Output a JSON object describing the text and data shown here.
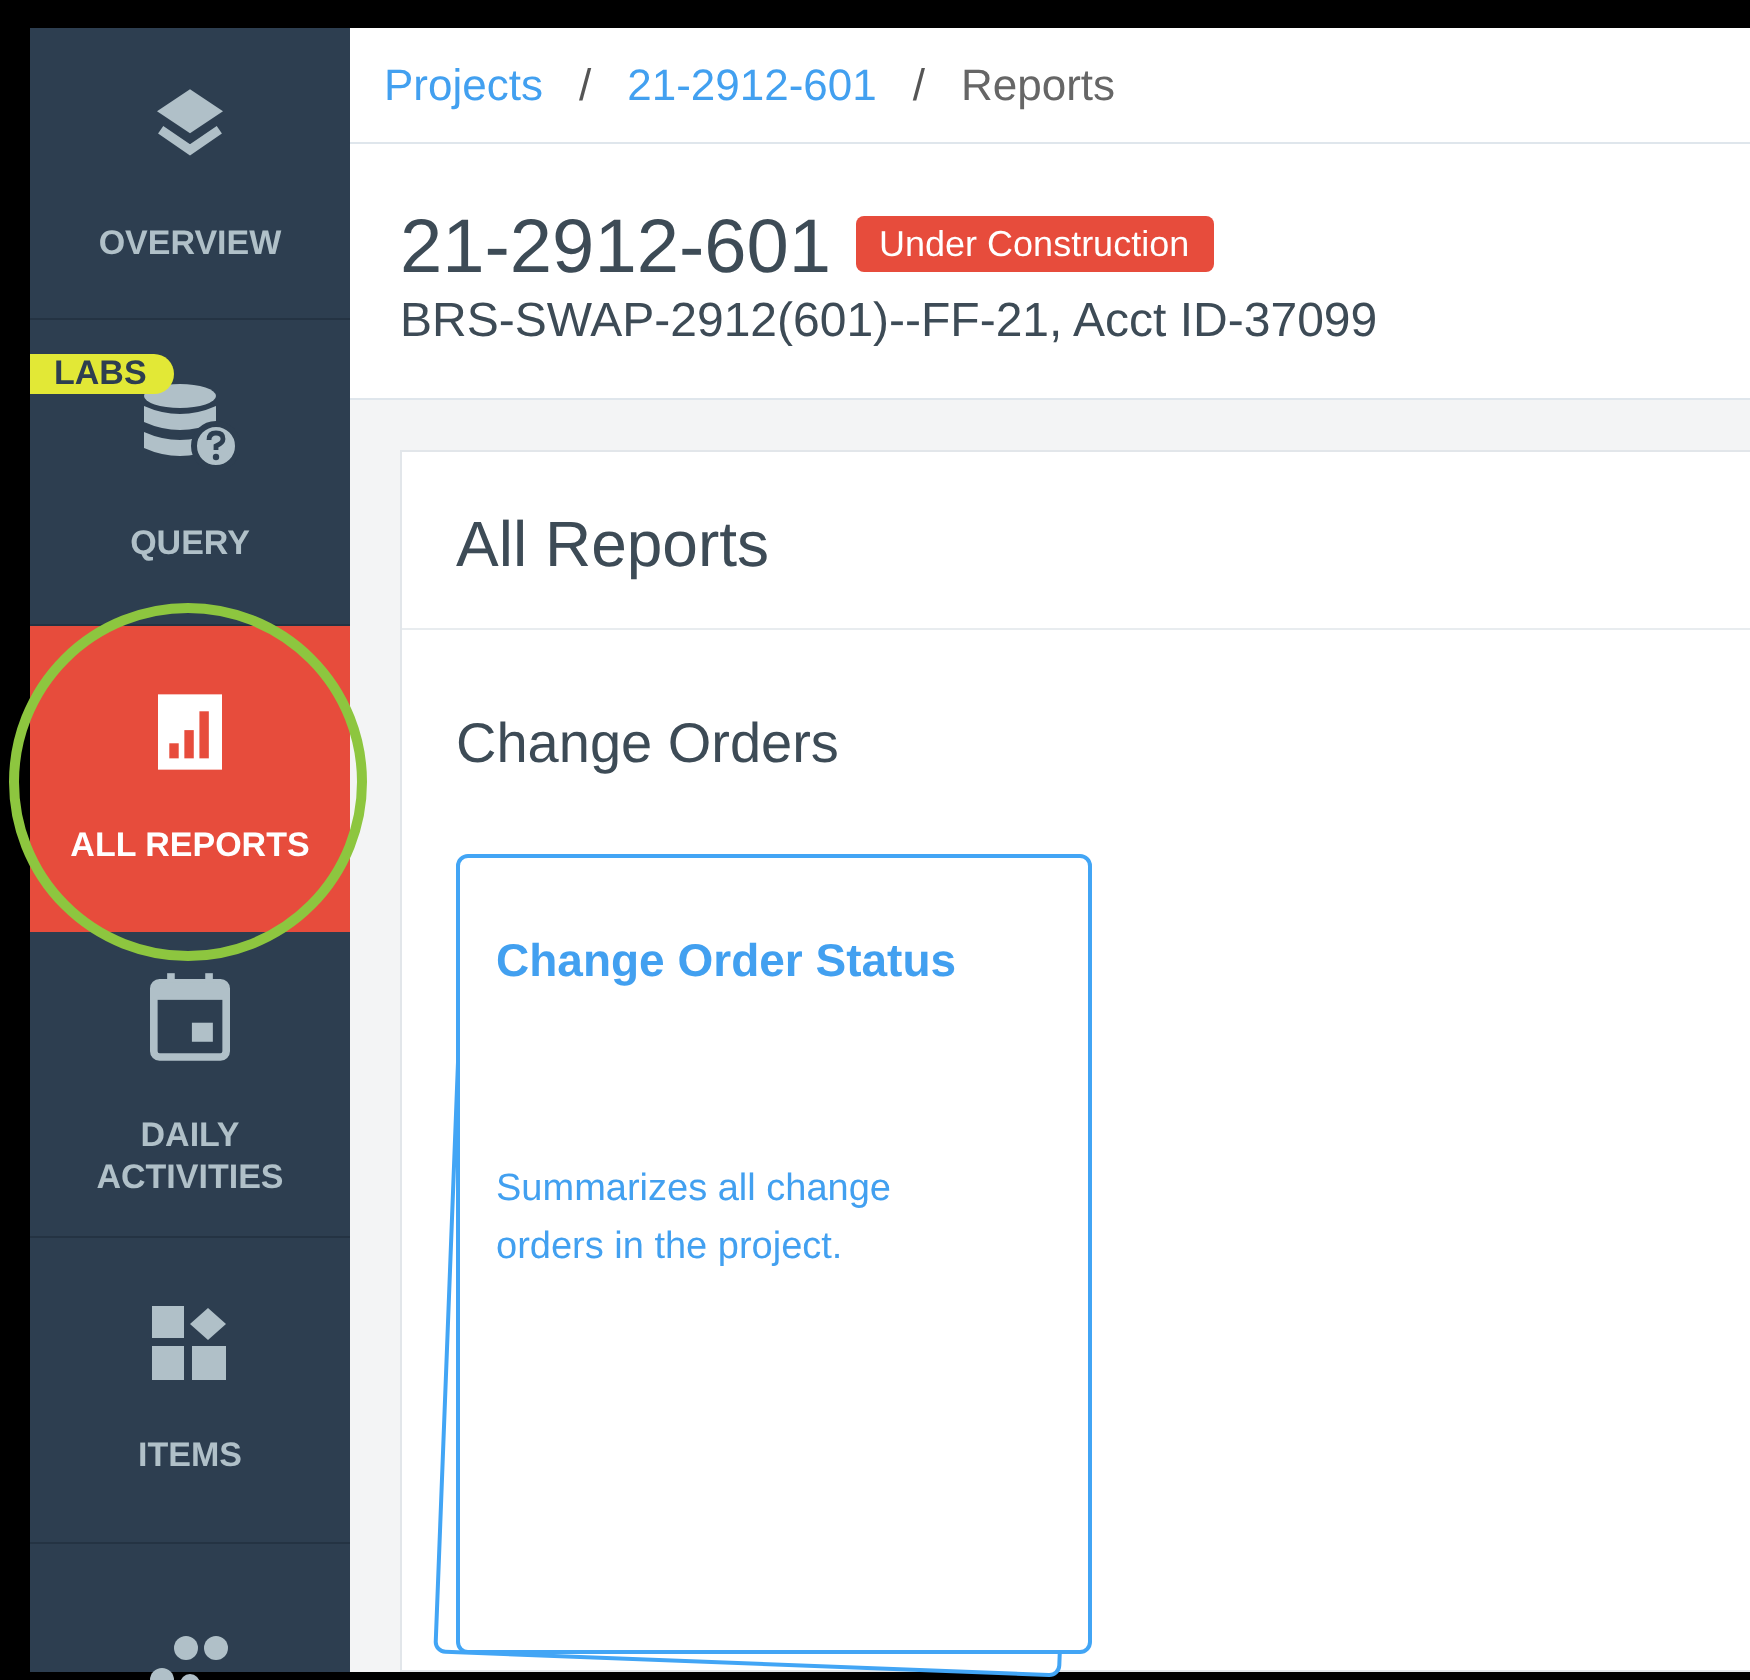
{
  "sidebar": {
    "items": [
      {
        "label": "OVERVIEW",
        "selected": false
      },
      {
        "label": "QUERY",
        "badge": "LABS",
        "selected": false
      },
      {
        "label": "ALL REPORTS",
        "selected": true
      },
      {
        "label": "DAILY ACTIVITIES",
        "selected": false
      },
      {
        "label": "ITEMS",
        "selected": false
      },
      {
        "selected": false
      }
    ]
  },
  "annotation": {
    "kind": "circle"
  },
  "breadcrumb": [
    {
      "kind": "link",
      "label": "Projects"
    },
    {
      "kind": "separator",
      "label": "/"
    },
    {
      "kind": "link",
      "label": "21-2912-601"
    },
    {
      "kind": "separator",
      "label": "/"
    },
    {
      "kind": "current",
      "label": "Reports"
    }
  ],
  "project": {
    "title": "21-2912-601",
    "status": "Under Construction",
    "subtitle": "BRS-SWAP-2912(601)--FF-21, Acct ID-37099"
  },
  "panel": {
    "title": "All Reports",
    "sections": [
      {
        "title": "Change Orders",
        "reports": [
          {
            "title": "Change Order Status",
            "description": "Summarizes all change orders in the project."
          }
        ]
      }
    ]
  }
}
